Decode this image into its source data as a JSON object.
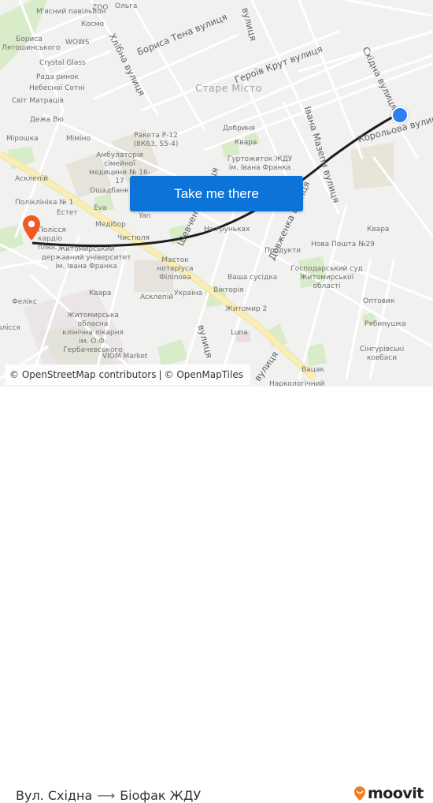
{
  "map": {
    "district_label": "Старе Місто",
    "streets": [
      {
        "name": "Бориса Тена вулиця"
      },
      {
        "name": "Героїв Крут вулиця"
      },
      {
        "name": "Хлібна вулиця"
      },
      {
        "name": "Східна вулиця"
      },
      {
        "name": "Корольова вулиця"
      },
      {
        "name": "Івана Мазепи вулиця"
      },
      {
        "name": "Довженка вулиця"
      },
      {
        "name": "Шевченка вулиця"
      },
      {
        "name": "вулиця"
      },
      {
        "name": "вулиця"
      },
      {
        "name": "вулиця"
      }
    ],
    "pois": [
      "М'ясний павільйон",
      "ZOO",
      "Ольга",
      "Космо",
      "Бориса Лятошинського",
      "WOWS",
      "Crystal Glass",
      "Рада ринок",
      "Небесної Сотні",
      "Світ Матраців",
      "Дежа Вю",
      "Мірошка",
      "Мімінo",
      "Ракета Р-12 (8К63, S5-4)",
      "Амбулаторія сімейної медицини № 16-17",
      "Добриня",
      "Квара",
      "Гуртожиток ЖДУ ім. Івана Франка",
      "Асклепій",
      "Ощадбанк",
      "Поліклініка № 1",
      "Eva",
      "Естет",
      "Yan",
      "Медібор",
      "Полісся кардіо плюс",
      "Чистюля",
      "На грyньках",
      "Житомирський державний університет ім. Івана Франка",
      "Маєток нотаріуса Філіпова",
      "Продукти",
      "Нова Пошта №29",
      "Квара",
      "Господарський суд Житомирської області",
      "Ваша сусідка",
      "Квара",
      "Асклепій",
      "Україна",
      "Вікторія",
      "Житомир 2",
      "Фелікс",
      "Полісся",
      "Житомирська обласна клінічна лікарня ім. О.Ф. Гербачевського",
      "Luna",
      "VIOM Market",
      "Оптовик",
      "Рябинушка",
      "Сінгурівські ковбаси",
      "Вацак",
      "Наркологічний"
    ],
    "cta_button": "Take me there",
    "attribution": {
      "osm": "© OpenStreetMap contributors",
      "sep": "|",
      "omt": "© OpenMapTiles"
    },
    "origin_color": "#2d80f0",
    "destination_color": "#f05a22",
    "route_color": "#1e1e1e"
  },
  "footer": {
    "origin": "Вул. Східна",
    "arrow": "⟶",
    "destination": "Біофак ЖДУ",
    "brand": "moovit",
    "brand_color": "#f47b20"
  }
}
